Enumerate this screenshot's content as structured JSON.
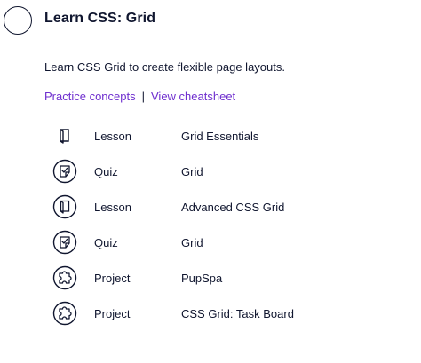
{
  "module": {
    "title": "Learn CSS: Grid",
    "description": "Learn CSS Grid to create flexible page layouts.",
    "links": [
      {
        "label": "Practice concepts"
      },
      {
        "label": "View cheatsheet"
      }
    ],
    "link_separator": "|",
    "items": [
      {
        "type": "Lesson",
        "name": "Grid Essentials",
        "icon": "lesson-book-icon",
        "icon_style": "plain"
      },
      {
        "type": "Quiz",
        "name": "Grid",
        "icon": "quiz-icon",
        "icon_style": "circle"
      },
      {
        "type": "Lesson",
        "name": "Advanced CSS Grid",
        "icon": "lesson-book-icon",
        "icon_style": "circle"
      },
      {
        "type": "Quiz",
        "name": "Grid",
        "icon": "quiz-icon",
        "icon_style": "circle"
      },
      {
        "type": "Project",
        "name": "PupSpa",
        "icon": "project-puzzle-icon",
        "icon_style": "circle"
      },
      {
        "type": "Project",
        "name": "CSS Grid: Task Board",
        "icon": "project-puzzle-icon",
        "icon_style": "circle"
      }
    ]
  },
  "colors": {
    "text": "#10162f",
    "link": "#6f2fcf",
    "background": "#ffffff"
  }
}
